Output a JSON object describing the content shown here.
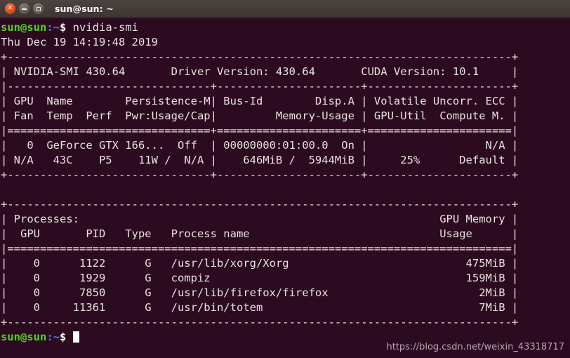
{
  "window": {
    "title": "sun@sun: ~",
    "buttons": {
      "close": "×",
      "minimize": "",
      "maximize": ""
    }
  },
  "terminal": {
    "prompt": {
      "user_host": "sun@sun",
      "path": ":~",
      "sigil": "$"
    },
    "command": " nvidia-smi",
    "date_line": "Thu Dec 19 14:19:48 2019",
    "smi_lines": [
      "+-----------------------------------------------------------------------------+",
      "| NVIDIA-SMI 430.64       Driver Version: 430.64       CUDA Version: 10.1     |",
      "|-------------------------------+----------------------+----------------------+",
      "| GPU  Name        Persistence-M| Bus-Id        Disp.A | Volatile Uncorr. ECC |",
      "| Fan  Temp  Perf  Pwr:Usage/Cap|         Memory-Usage | GPU-Util  Compute M. |",
      "|===============================+======================+======================|",
      "|   0  GeForce GTX 166...  Off  | 00000000:01:00.0  On |                  N/A |",
      "| N/A   43C    P5    11W /  N/A |    646MiB /  5944MiB |     25%      Default |",
      "+-------------------------------+----------------------+----------------------+",
      "",
      "+-----------------------------------------------------------------------------+",
      "| Processes:                                                       GPU Memory |",
      "|  GPU       PID   Type   Process name                             Usage      |",
      "|=============================================================================|",
      "|    0      1122      G   /usr/lib/xorg/Xorg                           475MiB |",
      "|    0      1929      G   compiz                                       159MiB |",
      "|    0      7850      G   /usr/lib/firefox/firefox                       2MiB |",
      "|    0     11361      G   /usr/bin/totem                                 7MiB |",
      "+-----------------------------------------------------------------------------+"
    ],
    "watermark": "https://blog.csdn.net/weixin_43318717"
  },
  "nvidia_smi": {
    "version": "430.64",
    "driver_version": "430.64",
    "cuda_version": "10.1",
    "gpu_table": {
      "headers_row1": [
        "GPU",
        "Name",
        "Persistence-M",
        "Bus-Id",
        "Disp.A",
        "Volatile Uncorr. ECC"
      ],
      "headers_row2": [
        "Fan",
        "Temp",
        "Perf",
        "Pwr:Usage/Cap",
        "Memory-Usage",
        "GPU-Util",
        "Compute M."
      ],
      "rows": [
        {
          "gpu": "0",
          "name": "GeForce GTX 166...",
          "persistence_m": "Off",
          "bus_id": "00000000:01:00.0",
          "disp_a": "On",
          "ecc": "N/A",
          "fan": "N/A",
          "temp": "43C",
          "perf": "P5",
          "pwr_usage_cap": "11W /  N/A",
          "memory_usage": "646MiB /  5944MiB",
          "gpu_util": "25%",
          "compute_m": "Default"
        }
      ]
    },
    "processes_table": {
      "title": "Processes:",
      "memory_header": "GPU Memory",
      "headers": [
        "GPU",
        "PID",
        "Type",
        "Process name",
        "Usage"
      ],
      "rows": [
        {
          "gpu": "0",
          "pid": "1122",
          "type": "G",
          "name": "/usr/lib/xorg/Xorg",
          "usage": "475MiB"
        },
        {
          "gpu": "0",
          "pid": "1929",
          "type": "G",
          "name": "compiz",
          "usage": "159MiB"
        },
        {
          "gpu": "0",
          "pid": "7850",
          "type": "G",
          "name": "/usr/lib/firefox/firefox",
          "usage": "2MiB"
        },
        {
          "gpu": "0",
          "pid": "11361",
          "type": "G",
          "name": "/usr/bin/totem",
          "usage": "7MiB"
        }
      ]
    }
  },
  "colors": {
    "terminal_bg": "#2c0b20",
    "titlebar_bg": "#3c3633",
    "prompt_green": "#4fd318",
    "prompt_blue": "#5c75d6",
    "text": "#e8e2dc",
    "close_button": "#dd4814"
  }
}
